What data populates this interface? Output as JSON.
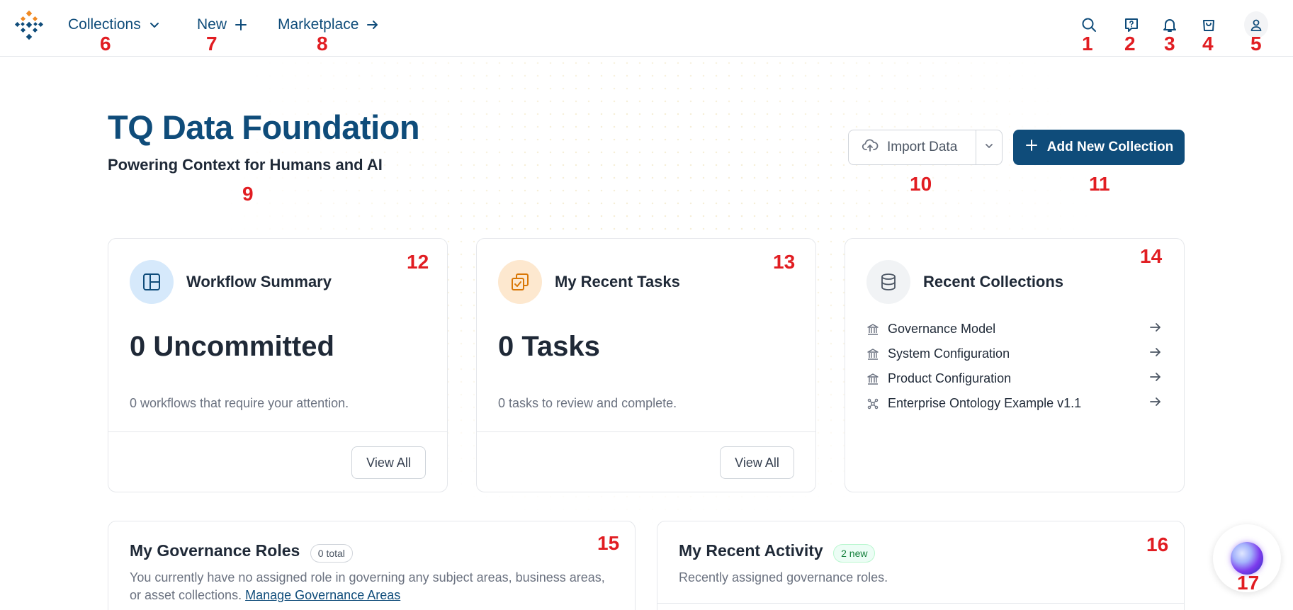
{
  "topbar": {
    "nav": [
      {
        "label": "Collections",
        "icon": "chevron-down-icon"
      },
      {
        "label": "New",
        "icon": "plus-icon"
      },
      {
        "label": "Marketplace",
        "icon": "arrow-right-icon"
      }
    ],
    "icons": [
      "search-icon",
      "help-icon",
      "bell-icon",
      "cart-icon",
      "user-icon"
    ]
  },
  "hero": {
    "title": "TQ Data Foundation",
    "subtitle": "Powering Context for Humans and AI",
    "import_label": "Import Data",
    "add_label": "Add New Collection"
  },
  "workflow": {
    "title": "Workflow Summary",
    "big": "0 Uncommitted",
    "desc": "0 workflows that require your attention.",
    "button": "View All"
  },
  "tasks": {
    "title": "My Recent Tasks",
    "big": "0 Tasks",
    "desc": "0 tasks to review and complete.",
    "button": "View All"
  },
  "recent_collections": {
    "title": "Recent Collections",
    "items": [
      {
        "label": "Governance Model",
        "icon": "bank-icon"
      },
      {
        "label": "System Configuration",
        "icon": "bank-icon"
      },
      {
        "label": "Product Configuration",
        "icon": "bank-icon"
      },
      {
        "label": "Enterprise Ontology Example v1.1",
        "icon": "network-icon"
      }
    ]
  },
  "governance": {
    "title": "My Governance Roles",
    "badge": "0 total",
    "text": "You currently have no assigned role in governing any subject areas, business areas, or asset collections.",
    "link": "Manage Governance Areas"
  },
  "activity": {
    "title": "My Recent Activity",
    "badge": "2 new",
    "text": "Recently assigned governance roles."
  },
  "markers": [
    "1",
    "2",
    "3",
    "4",
    "5",
    "6",
    "7",
    "8",
    "9",
    "10",
    "11",
    "12",
    "13",
    "14",
    "15",
    "16",
    "17"
  ],
  "colors": {
    "brand": "#0f4c7a",
    "accent_orange": "#f08a24",
    "marker_red": "#e11d22"
  }
}
